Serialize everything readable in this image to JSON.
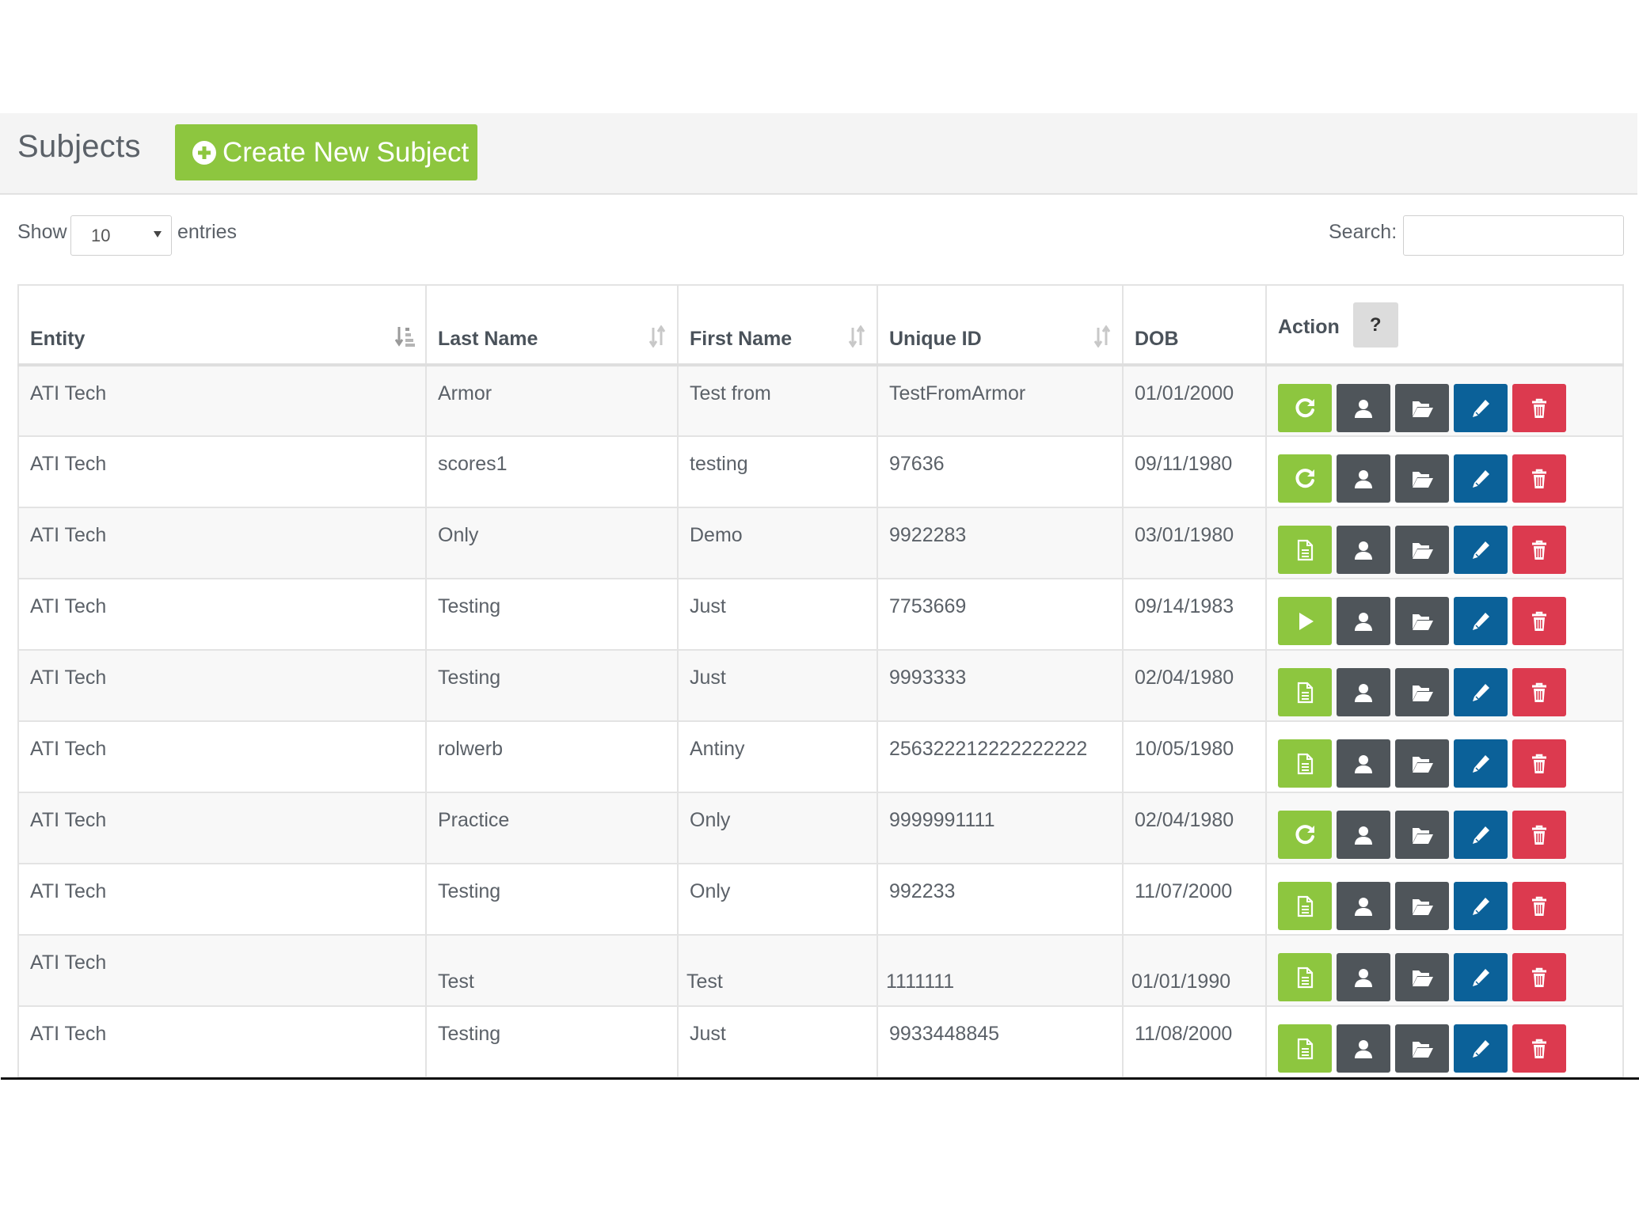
{
  "header": {
    "title": "Subjects",
    "create_button_label": "Create New Subject",
    "create_button_icon": "plus-circle-icon"
  },
  "controls": {
    "show_label": "Show",
    "page_length": "10",
    "entries_label": "entries",
    "search_label": "Search:",
    "search_value": "",
    "search_placeholder": ""
  },
  "table": {
    "columns": [
      {
        "label": "Entity",
        "sort": "sorted-asc"
      },
      {
        "label": "Last Name",
        "sort": "sortable"
      },
      {
        "label": "First Name",
        "sort": "sortable"
      },
      {
        "label": "Unique ID",
        "sort": "sortable"
      },
      {
        "label": "DOB",
        "sort": "none"
      },
      {
        "label": "Action",
        "sort": "none",
        "help_label": "?"
      }
    ],
    "rows": [
      {
        "entity": "ATI Tech",
        "last_name": "Armor",
        "first_name": "Test from",
        "unique_id": "TestFromArmor",
        "dob": "01/01/2000",
        "primary_action": "refresh"
      },
      {
        "entity": "ATI Tech",
        "last_name": "scores1",
        "first_name": "testing",
        "unique_id": "97636",
        "dob": "09/11/1980",
        "primary_action": "refresh"
      },
      {
        "entity": "ATI Tech",
        "last_name": "Only",
        "first_name": "Demo",
        "unique_id": "9922283",
        "dob": "03/01/1980",
        "primary_action": "document"
      },
      {
        "entity": "ATI Tech",
        "last_name": "Testing",
        "first_name": "Just",
        "unique_id": "7753669",
        "dob": "09/14/1983",
        "primary_action": "play"
      },
      {
        "entity": "ATI Tech",
        "last_name": "Testing",
        "first_name": "Just",
        "unique_id": "9993333",
        "dob": "02/04/1980",
        "primary_action": "document"
      },
      {
        "entity": "ATI Tech",
        "last_name": "rolwerb",
        "first_name": "Antiny",
        "unique_id": "256322212222222222",
        "dob": "10/05/1980",
        "primary_action": "document"
      },
      {
        "entity": "ATI Tech",
        "last_name": "Practice",
        "first_name": "Only",
        "unique_id": "9999991111",
        "dob": "02/04/1980",
        "primary_action": "refresh"
      },
      {
        "entity": "ATI Tech",
        "last_name": "Testing",
        "first_name": "Only",
        "unique_id": "992233",
        "dob": "11/07/2000",
        "primary_action": "document"
      },
      {
        "entity": "ATI Tech",
        "last_name": "Test",
        "first_name": "Test",
        "unique_id": "1111111",
        "dob": "01/01/1990",
        "primary_action": "document"
      },
      {
        "entity": "ATI Tech",
        "last_name": "Testing",
        "first_name": "Just",
        "unique_id": "9933448845",
        "dob": "11/08/2000",
        "primary_action": "document"
      }
    ],
    "row_actions": [
      {
        "name": "primary",
        "color": "#8dc63f"
      },
      {
        "name": "profile",
        "icon": "user-icon",
        "color": "#4f555a"
      },
      {
        "name": "files",
        "icon": "folder-open-icon",
        "color": "#4f555a"
      },
      {
        "name": "edit",
        "icon": "pencil-icon",
        "color": "#0b6199"
      },
      {
        "name": "delete",
        "icon": "trash-icon",
        "color": "#dc3a4f"
      }
    ]
  },
  "colors": {
    "brand_green": "#8dc63f",
    "dark_gray": "#4f555a",
    "blue": "#0b6199",
    "red": "#dc3a4f",
    "header_band": "#f4f4f4"
  }
}
